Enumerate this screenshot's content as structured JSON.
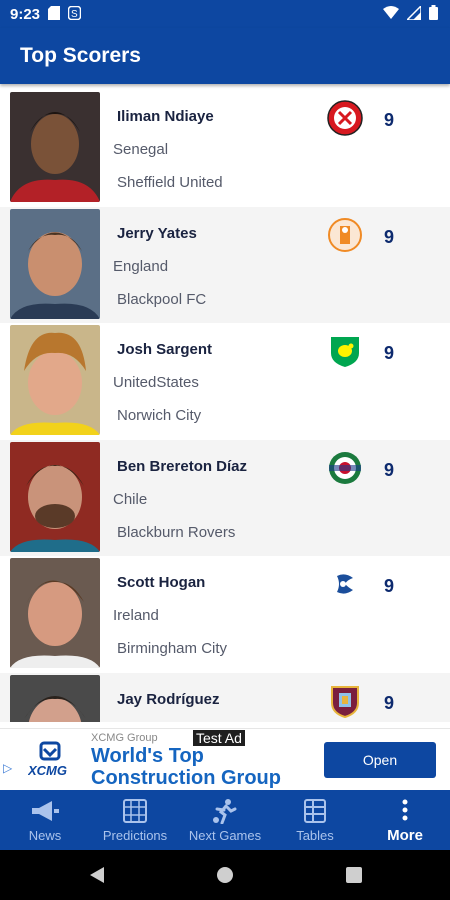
{
  "status_bar": {
    "time": "9:23",
    "icons": [
      "sd-card-icon",
      "sync-icon",
      "wifi-icon",
      "signal-icon",
      "battery-icon"
    ]
  },
  "app_bar": {
    "title": "Top Scorers"
  },
  "scorers": [
    {
      "name": "Iliman Ndiaye",
      "country": "Senegal",
      "team": "Sheffield United",
      "goals": "9",
      "badge": "sheffield-united-badge-icon"
    },
    {
      "name": "Jerry Yates",
      "country": "England",
      "team": "Blackpool FC",
      "goals": "9",
      "badge": "blackpool-badge-icon"
    },
    {
      "name": "Josh Sargent",
      "country": "UnitedStates",
      "team": "Norwich City",
      "goals": "9",
      "badge": "norwich-badge-icon"
    },
    {
      "name": "Ben Brereton Díaz",
      "country": "Chile",
      "team": "Blackburn Rovers",
      "goals": "9",
      "badge": "blackburn-badge-icon"
    },
    {
      "name": "Scott Hogan",
      "country": "Ireland",
      "team": "Birmingham City",
      "goals": "9",
      "badge": "birmingham-badge-icon"
    },
    {
      "name": "Jay Rodríguez",
      "country": "",
      "team": "",
      "goals": "9",
      "badge": "burnley-badge-icon"
    }
  ],
  "ad": {
    "brand": "XCMG Group",
    "label": "Test Ad",
    "headline": "World's Top Construction Group",
    "button": "Open",
    "logo_text": "XCMG"
  },
  "bottom_nav": [
    {
      "label": "News",
      "icon": "megaphone-icon"
    },
    {
      "label": "Predictions",
      "icon": "grid-icon"
    },
    {
      "label": "Next Games",
      "icon": "player-kick-icon"
    },
    {
      "label": "Tables",
      "icon": "table-icon"
    },
    {
      "label": "More",
      "icon": "more-vertical-icon",
      "active": true
    }
  ],
  "colors": {
    "primary": "#0d47a1",
    "ad_headline": "#1565c0",
    "row_alt": "#f4f4f4"
  }
}
